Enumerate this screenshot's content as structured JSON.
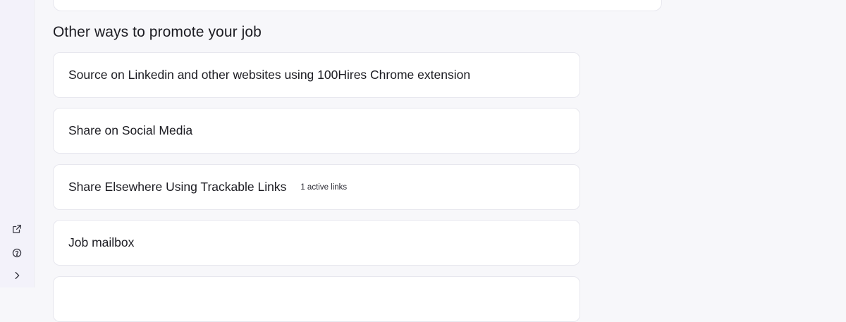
{
  "sidebar": {
    "icons": [
      {
        "name": "external-link-icon"
      },
      {
        "name": "help-circle-icon"
      },
      {
        "name": "chevron-right-icon"
      }
    ]
  },
  "section": {
    "title": "Other ways to promote your job"
  },
  "cards": [
    {
      "label": "Source on Linkedin and other websites using 100Hires Chrome extension",
      "badge": ""
    },
    {
      "label": "Share on Social Media",
      "badge": ""
    },
    {
      "label": "Share Elsewhere Using Trackable Links",
      "badge": "1 active links"
    },
    {
      "label": "Job mailbox",
      "badge": ""
    }
  ]
}
